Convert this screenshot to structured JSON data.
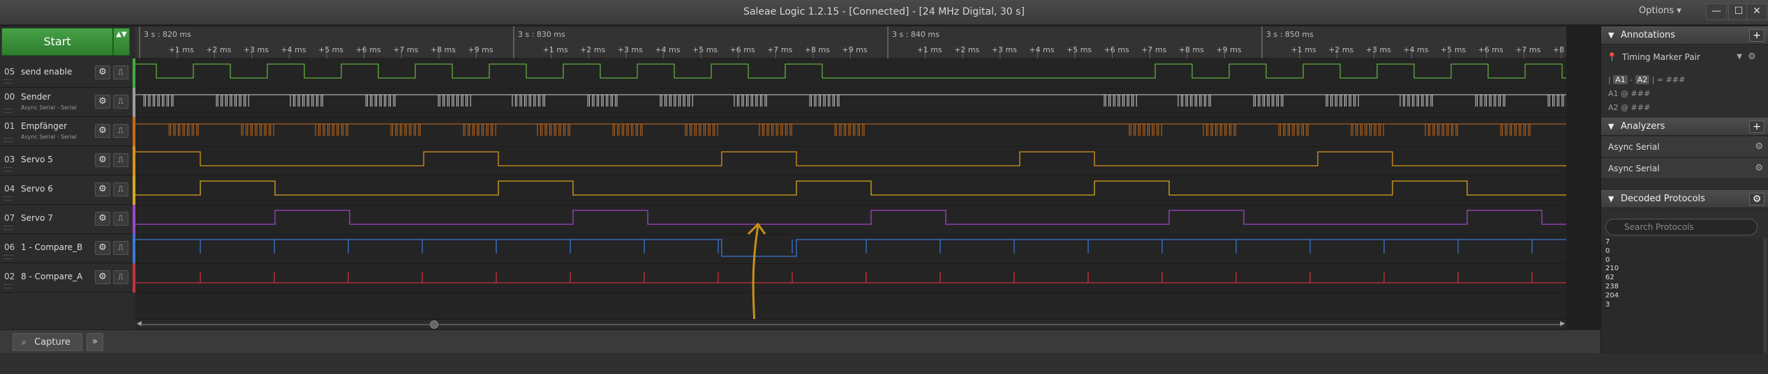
{
  "window": {
    "title": "Saleae Logic 1.2.15 - [Connected] - [24 MHz Digital, 30 s]",
    "options_label": "Options ▾",
    "min_glyph": "—",
    "max_glyph": "☐",
    "close_glyph": "✕"
  },
  "start": {
    "label": "Start",
    "opts_glyph": "▲▼"
  },
  "timeline": {
    "major": [
      "3 s : 820 ms",
      "3 s : 830 ms",
      "3 s : 840 ms",
      "3 s : 850 ms"
    ],
    "minor": [
      "+1 ms",
      "+2 ms",
      "+3 ms",
      "+4 ms",
      "+5 ms",
      "+6 ms",
      "+7 ms",
      "+8 ms",
      "+9 ms"
    ]
  },
  "channels": [
    {
      "num": "05",
      "name": "send enable",
      "sub": "",
      "color": "#3fae3f",
      "wave": "#5fae3f",
      "type": "pulse_green"
    },
    {
      "num": "00",
      "name": "Sender",
      "sub": "Async Serial - Serial",
      "color": "#9e9e9e",
      "wave": "#d0d0d0",
      "type": "serial_white"
    },
    {
      "num": "01",
      "name": "Empfänger",
      "sub": "Async Serial - Serial",
      "color": "#c76a1a",
      "wave": "#c76a1a",
      "type": "serial_orange"
    },
    {
      "num": "03",
      "name": "Servo 5",
      "sub": "",
      "color": "#d8941e",
      "wave": "#d8941e",
      "type": "servo5"
    },
    {
      "num": "04",
      "name": "Servo 6",
      "sub": "",
      "color": "#d8a81e",
      "wave": "#d8a81e",
      "type": "servo6"
    },
    {
      "num": "07",
      "name": "Servo 7",
      "sub": "",
      "color": "#9d46c8",
      "wave": "#9d46c8",
      "type": "servo7"
    },
    {
      "num": "06",
      "name": "1 - Compare_B",
      "sub": "",
      "color": "#3a78d8",
      "wave": "#3a78d8",
      "type": "compare_b"
    },
    {
      "num": "02",
      "name": "8 - Compare_A",
      "sub": "",
      "color": "#c8323a",
      "wave": "#c8323a",
      "type": "compare_a"
    }
  ],
  "bottom": {
    "capture_label": "Capture",
    "expand_glyph": "»"
  },
  "annotations": {
    "title": "Annotations",
    "marker_label": "Timing Marker Pair",
    "line1_prefix": "|",
    "a1": "A1",
    "line1_mid": "-",
    "a2": "A2",
    "line1_suffix": "| = ###",
    "line2": "A1  @  ###",
    "line3": "A2  @  ###"
  },
  "analyzers": {
    "title": "Analyzers",
    "items": [
      "Async Serial",
      "Async Serial"
    ]
  },
  "decoded": {
    "title": "Decoded Protocols",
    "search_placeholder": "Search Protocols",
    "items": [
      "7",
      "0",
      "0",
      "210",
      "62",
      "238",
      "204",
      "3"
    ]
  }
}
